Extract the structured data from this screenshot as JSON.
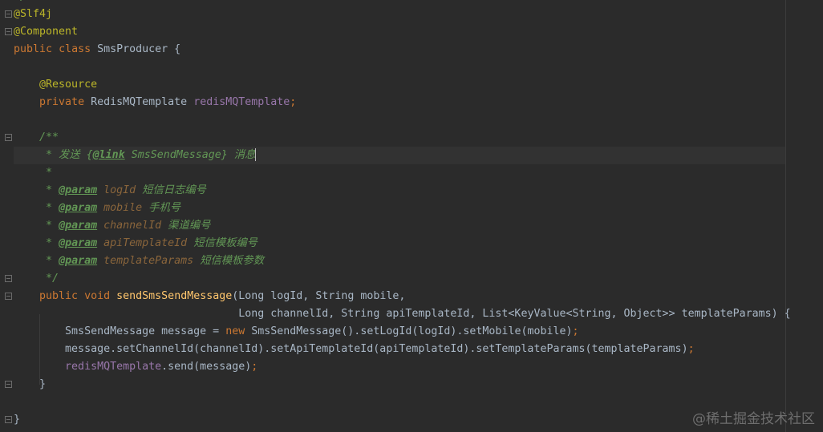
{
  "editor": {
    "top_partial": "*/",
    "ann_slf4j": "@Slf4j",
    "ann_component": "@Component",
    "class_decl": {
      "kw1": "public",
      "kw2": "class",
      "name": "SmsProducer",
      "brace": " {"
    },
    "ann_resource": "@Resource",
    "field_decl": {
      "kw": "private",
      "type": "RedisMQTemplate",
      "name": "redisMQTemplate",
      "semi": ";"
    },
    "doc_open": "/**",
    "doc_line1": {
      "star": " * 发送 {",
      "tag": "@link",
      "ref": " SmsSendMessage",
      "close": "} 消息"
    },
    "doc_blank": " *",
    "doc_params": [
      {
        "star": " * ",
        "tag": "@param",
        "name": " logId",
        "desc": " 短信日志编号"
      },
      {
        "star": " * ",
        "tag": "@param",
        "name": " mobile",
        "desc": " 手机号"
      },
      {
        "star": " * ",
        "tag": "@param",
        "name": " channelId",
        "desc": " 渠道编号"
      },
      {
        "star": " * ",
        "tag": "@param",
        "name": " apiTemplateId",
        "desc": " 短信模板编号"
      },
      {
        "star": " * ",
        "tag": "@param",
        "name": " templateParams",
        "desc": " 短信模板参数"
      }
    ],
    "doc_close": " */",
    "method_sig1": {
      "kw1": "public",
      "kw2": "void",
      "name": "sendSmsSendMessage",
      "rest": "(Long logId, String mobile,"
    },
    "method_sig2": "Long channelId, String apiTemplateId, List<KeyValue<String, Object>> templateParams) {",
    "body1": {
      "pre": "SmsSendMessage message = ",
      "kw": "new",
      "post": " SmsSendMessage().setLogId(logId).setMobile(mobile)",
      "semi": ";"
    },
    "body2": {
      "text": "message.setChannelId(channelId).setApiTemplateId(apiTemplateId).setTemplateParams(templateParams)",
      "semi": ";"
    },
    "body3": {
      "field": "redisMQTemplate",
      "post": ".send(message)",
      "semi": ";"
    },
    "close_method": "}",
    "close_class": "}"
  },
  "watermark": "@稀土掘金技术社区"
}
